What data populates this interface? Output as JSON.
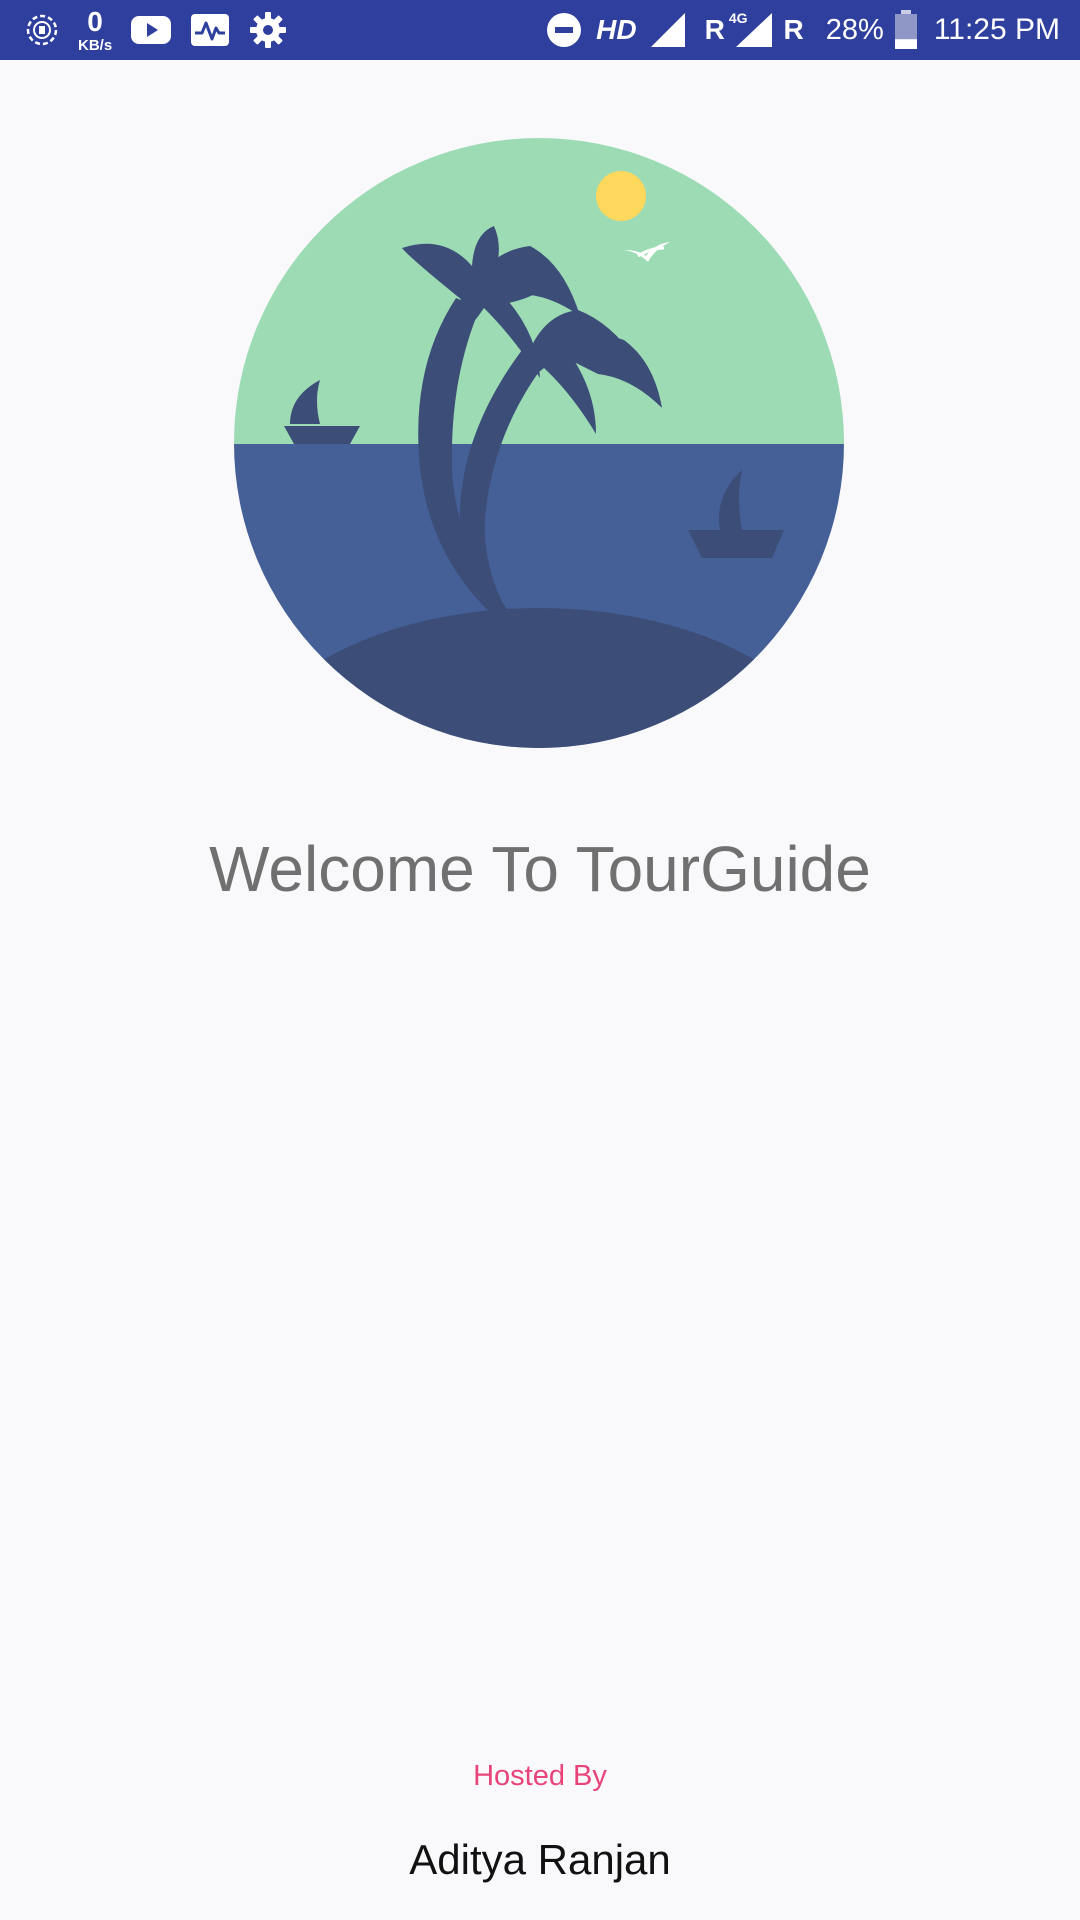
{
  "status_bar": {
    "network_speed_value": "0",
    "network_speed_unit": "KB/s",
    "hd_label": "HD",
    "roaming_label_1": "R",
    "network_type": "4G",
    "roaming_label_2": "R",
    "battery_percent": "28%",
    "battery_level": 0.28,
    "time": "11:25 PM",
    "left_icons": [
      "data-saver-icon",
      "youtube-icon",
      "activity-icon",
      "settings-gear-icon"
    ],
    "right_icons": [
      "do-not-disturb-icon",
      "signal-icon",
      "signal-4g-icon",
      "battery-icon"
    ]
  },
  "hero_image": {
    "icon": "tropical-island-icon",
    "colors": {
      "sky": "#9ddbb5",
      "sea": "#455f97",
      "island": "#3c4e78",
      "sun": "#fdd85d"
    }
  },
  "welcome_text": "Welcome To TourGuide",
  "footer": {
    "hosted_label": "Hosted By",
    "host_name": "Aditya Ranjan"
  },
  "colors": {
    "status_bar": "#2e3f9e",
    "background": "#f9f9fb",
    "welcome_text": "#707070",
    "accent": "#e8447a"
  }
}
